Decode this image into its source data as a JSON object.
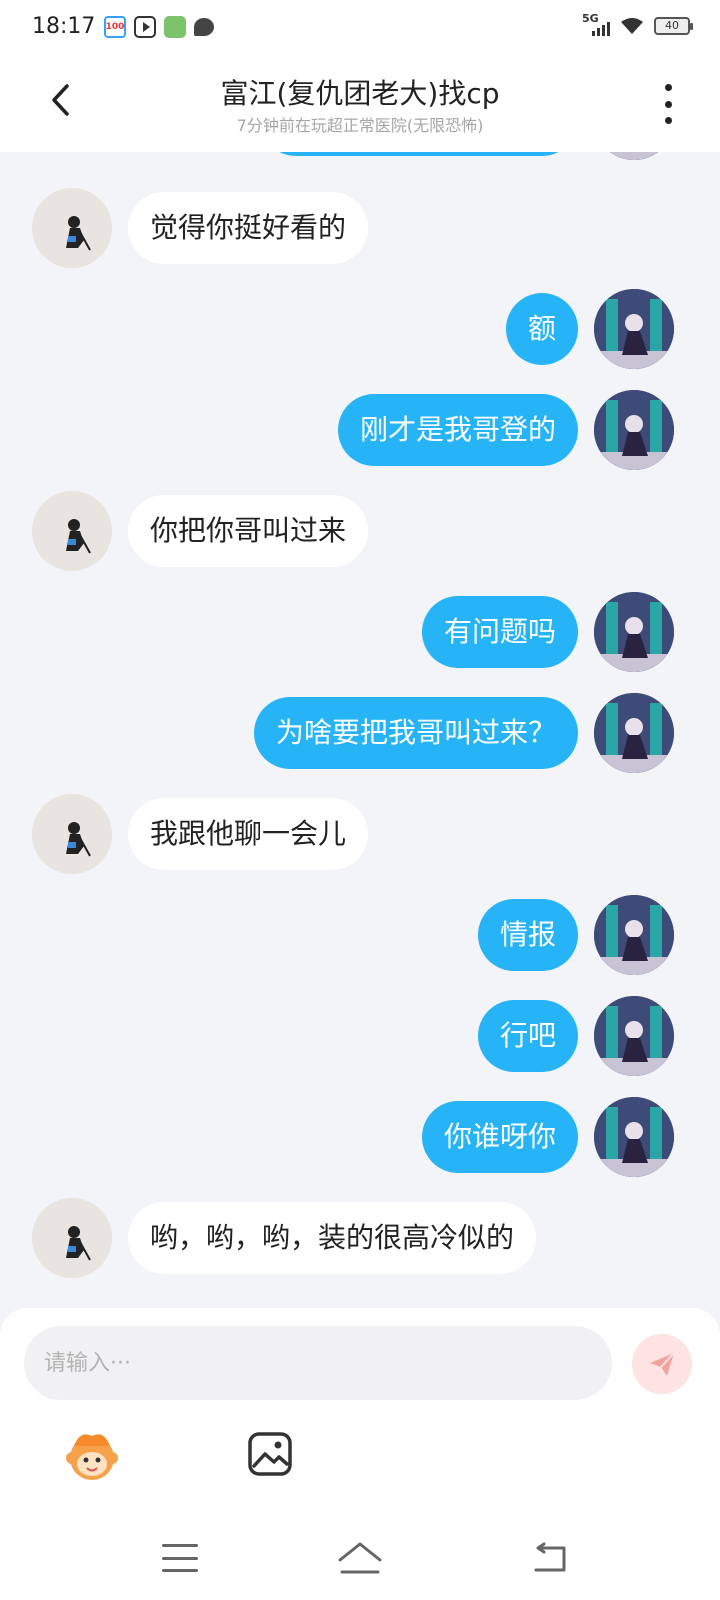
{
  "status_bar": {
    "time": "18:17",
    "network": "5G",
    "battery": "40",
    "notification_icons": [
      "news-100-icon",
      "video-play-icon",
      "game-mascot-icon",
      "chat-bubble-icon"
    ]
  },
  "header": {
    "title": "富江(复仇团老大)找cp",
    "subtitle": "7分钟前在玩超正常医院(无限恐怖)"
  },
  "colors": {
    "mine_bubble": "#27b4f7",
    "other_bubble": "#ffffff",
    "background": "#f2f4f7",
    "send_button_bg": "#fde3e1",
    "send_icon": "#f3a39d"
  },
  "messages": [
    {
      "sender": "other",
      "text": "觉得你挺好看的"
    },
    {
      "sender": "me",
      "text": "额"
    },
    {
      "sender": "me",
      "text": "刚才是我哥登的"
    },
    {
      "sender": "other",
      "text": "你把你哥叫过来"
    },
    {
      "sender": "me",
      "text": "有问题吗"
    },
    {
      "sender": "me",
      "text": "为啥要把我哥叫过来？"
    },
    {
      "sender": "other",
      "text": "我跟他聊一会儿"
    },
    {
      "sender": "me",
      "text": "情报"
    },
    {
      "sender": "me",
      "text": "行吧"
    },
    {
      "sender": "me",
      "text": "你谁呀你"
    },
    {
      "sender": "other",
      "text": "哟，哟，哟，装的很高冷似的"
    }
  ],
  "input": {
    "placeholder": "请输入···",
    "value": ""
  },
  "toolbar": {
    "icons": [
      "emoji-mascot-icon",
      "image-icon"
    ]
  },
  "nav_bar": {
    "icons": [
      "menu-icon",
      "home-icon",
      "back-icon"
    ]
  }
}
